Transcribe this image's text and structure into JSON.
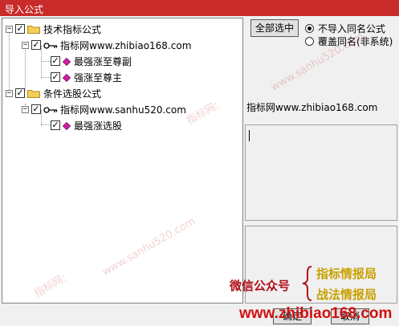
{
  "window": {
    "title": "导入公式"
  },
  "tree": {
    "groups": [
      {
        "label": "技术指标公式",
        "checked": true,
        "source": {
          "label": "指标网www.zhibiao168.com",
          "checked": true,
          "items": [
            {
              "label": "最强涨至尊副",
              "checked": true
            },
            {
              "label": "强涨至尊主",
              "checked": true
            }
          ]
        }
      },
      {
        "label": "条件选股公式",
        "checked": true,
        "source": {
          "label": "指标网www.sanhu520.com",
          "checked": true,
          "items": [
            {
              "label": "最强涨选股",
              "checked": true
            }
          ]
        }
      }
    ],
    "expander_symbol": "−",
    "check_symbol": "✓"
  },
  "actions": {
    "select_all_label": "全部选中",
    "ok_label": "确定",
    "cancel_label": "取消"
  },
  "options": {
    "no_import_same_name": {
      "label": "不导入同名公式",
      "selected": true
    },
    "overwrite_same_name": {
      "label": "覆盖同名(非系统)",
      "selected": false
    }
  },
  "detail": {
    "source_text": "指标网www.zhibiao168.com"
  },
  "overlay": {
    "watermark_url": "www.sanhu520.com",
    "watermark_brand": "指标网:",
    "promo_wechat": "微信公众号",
    "promo_line1": "指标情报局",
    "promo_line2": "战法情报局",
    "promo_url": "www.zhibiao168.com"
  },
  "colors": {
    "titlebar": "#c92a2a",
    "folder": "#f2cf58",
    "diamond": "#d81ba8",
    "promo_red": "#b0101a",
    "promo_gold": "#c8a000"
  }
}
